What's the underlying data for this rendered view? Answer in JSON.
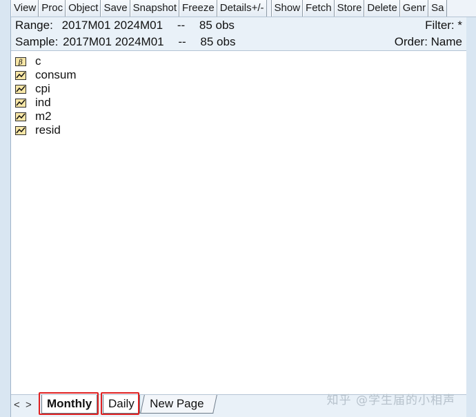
{
  "toolbar": {
    "buttons": [
      "View",
      "Proc",
      "Object",
      "Save",
      "Snapshot",
      "Freeze",
      "Details+/-",
      "Show",
      "Fetch",
      "Store",
      "Delete",
      "Genr",
      "Sa"
    ]
  },
  "info": {
    "range_label": "Range:",
    "range_value": "2017M01 2024M01",
    "range_sep": "--",
    "range_obs": "85 obs",
    "sample_label": "Sample:",
    "sample_value": "2017M01 2024M01",
    "sample_sep": "--",
    "sample_obs": "85 obs",
    "filter": "Filter: *",
    "order": "Order: Name"
  },
  "objects": [
    {
      "name": "c",
      "icon": "coefficient-vector-icon"
    },
    {
      "name": "consum",
      "icon": "series-icon"
    },
    {
      "name": "cpi",
      "icon": "series-icon"
    },
    {
      "name": "ind",
      "icon": "series-icon"
    },
    {
      "name": "m2",
      "icon": "series-icon"
    },
    {
      "name": "resid",
      "icon": "series-icon"
    }
  ],
  "tabs": {
    "prev": "<",
    "next": ">",
    "monthly": "Monthly",
    "daily": "Daily",
    "new_page": "New Page"
  },
  "watermark": "知乎 @学生届的小相声",
  "colors": {
    "highlight": "#e02020",
    "icon_fill": "#f7e6a6"
  }
}
